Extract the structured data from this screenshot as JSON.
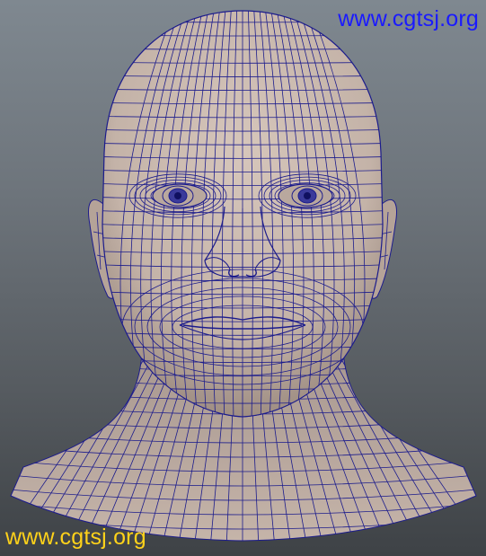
{
  "watermarks": {
    "top_right": "www.cgtsj.org",
    "bottom_left": "www.cgtsj.org"
  },
  "colors": {
    "skin": "#c7b6ab",
    "wire": "#1c1c8c",
    "watermark_top": "#1a1aff",
    "watermark_bottom": "#ffd21a"
  }
}
